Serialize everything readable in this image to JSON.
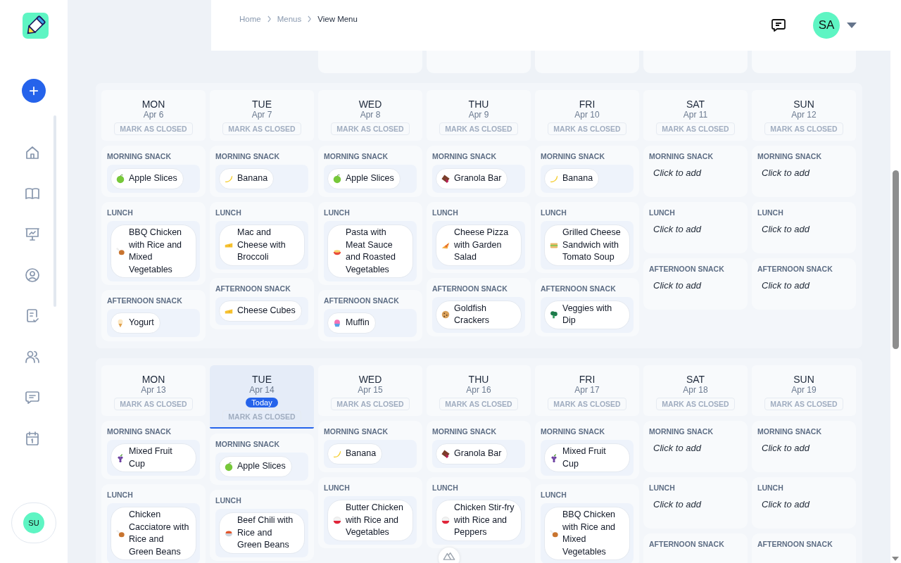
{
  "breadcrumb": [
    {
      "label": "Home",
      "current": false
    },
    {
      "label": "Menus",
      "current": false
    },
    {
      "label": "View Menu",
      "current": true
    }
  ],
  "user": {
    "initials": "SA"
  },
  "sidebar_user": {
    "initials": "SU"
  },
  "weeks": [
    {
      "days": [
        {
          "day": "MON",
          "date": "Apr 6",
          "today": false,
          "action": "MARK AS CLOSED",
          "meals": [
            {
              "label": "MORNING SNACK",
              "items": [
                {
                  "name": "Apple Slices",
                  "kind": "apple"
                }
              ]
            },
            {
              "label": "LUNCH",
              "items": [
                {
                  "name": "BBQ Chicken with Rice and Mixed Vegetables",
                  "kind": "drumstick"
                }
              ]
            },
            {
              "label": "AFTERNOON SNACK",
              "items": [
                {
                  "name": "Yogurt",
                  "kind": "icecream"
                }
              ]
            }
          ]
        },
        {
          "day": "TUE",
          "date": "Apr 7",
          "today": false,
          "action": "MARK AS CLOSED",
          "meals": [
            {
              "label": "MORNING SNACK",
              "items": [
                {
                  "name": "Banana",
                  "kind": "banana"
                }
              ]
            },
            {
              "label": "LUNCH",
              "items": [
                {
                  "name": "Mac and Cheese with Broccoli",
                  "kind": "cheese"
                }
              ]
            },
            {
              "label": "AFTERNOON SNACK",
              "items": [
                {
                  "name": "Cheese Cubes",
                  "kind": "cheese"
                }
              ]
            }
          ]
        },
        {
          "day": "WED",
          "date": "Apr 8",
          "today": false,
          "action": "MARK AS CLOSED",
          "meals": [
            {
              "label": "MORNING SNACK",
              "items": [
                {
                  "name": "Apple Slices",
                  "kind": "apple"
                }
              ]
            },
            {
              "label": "LUNCH",
              "items": [
                {
                  "name": "Pasta with Meat Sauce and Roasted Vegetables",
                  "kind": "pasta"
                }
              ]
            },
            {
              "label": "AFTERNOON SNACK",
              "items": [
                {
                  "name": "Muffin",
                  "kind": "cupcake"
                }
              ]
            }
          ]
        },
        {
          "day": "THU",
          "date": "Apr 9",
          "today": false,
          "action": "MARK AS CLOSED",
          "meals": [
            {
              "label": "MORNING SNACK",
              "items": [
                {
                  "name": "Granola Bar",
                  "kind": "chocolate"
                }
              ]
            },
            {
              "label": "LUNCH",
              "items": [
                {
                  "name": "Cheese Pizza with Garden Salad",
                  "kind": "pizza"
                }
              ]
            },
            {
              "label": "AFTERNOON SNACK",
              "items": [
                {
                  "name": "Goldfish Crackers",
                  "kind": "cookie"
                }
              ]
            }
          ]
        },
        {
          "day": "FRI",
          "date": "Apr 10",
          "today": false,
          "action": "MARK AS CLOSED",
          "meals": [
            {
              "label": "MORNING SNACK",
              "items": [
                {
                  "name": "Banana",
                  "kind": "banana"
                }
              ]
            },
            {
              "label": "LUNCH",
              "items": [
                {
                  "name": "Grilled Cheese Sandwich with Tomato Soup",
                  "kind": "sandwich"
                }
              ]
            },
            {
              "label": "AFTERNOON SNACK",
              "items": [
                {
                  "name": "Veggies with Dip",
                  "kind": "broccoli"
                }
              ]
            }
          ]
        },
        {
          "day": "SAT",
          "date": "Apr 11",
          "today": false,
          "action": "MARK AS CLOSED",
          "meals": [
            {
              "label": "MORNING SNACK",
              "prompt": "Click to add"
            },
            {
              "label": "LUNCH",
              "prompt": "Click to add"
            },
            {
              "label": "AFTERNOON SNACK",
              "prompt": "Click to add"
            }
          ]
        },
        {
          "day": "SUN",
          "date": "Apr 12",
          "today": false,
          "action": "MARK AS CLOSED",
          "meals": [
            {
              "label": "MORNING SNACK",
              "prompt": "Click to add"
            },
            {
              "label": "LUNCH",
              "prompt": "Click to add"
            },
            {
              "label": "AFTERNOON SNACK",
              "prompt": "Click to add"
            }
          ]
        }
      ]
    },
    {
      "days": [
        {
          "day": "MON",
          "date": "Apr 13",
          "today": false,
          "action": "MARK AS CLOSED",
          "meals": [
            {
              "label": "MORNING SNACK",
              "items": [
                {
                  "name": "Mixed Fruit Cup",
                  "kind": "grapes"
                }
              ]
            },
            {
              "label": "LUNCH",
              "items": [
                {
                  "name": "Chicken Cacciatore with Rice and Green Beans",
                  "kind": "drumstick"
                }
              ]
            }
          ]
        },
        {
          "day": "TUE",
          "date": "Apr 14",
          "today": true,
          "badge": "Today",
          "action": "MARK AS CLOSED",
          "meals": [
            {
              "label": "MORNING SNACK",
              "items": [
                {
                  "name": "Apple Slices",
                  "kind": "apple"
                }
              ]
            },
            {
              "label": "LUNCH",
              "items": [
                {
                  "name": "Beef Chili with Rice and Green Beans",
                  "kind": "stew"
                }
              ]
            }
          ]
        },
        {
          "day": "WED",
          "date": "Apr 15",
          "today": false,
          "action": "MARK AS CLOSED",
          "meals": [
            {
              "label": "MORNING SNACK",
              "items": [
                {
                  "name": "Banana",
                  "kind": "banana"
                }
              ]
            },
            {
              "label": "LUNCH",
              "items": [
                {
                  "name": "Butter Chicken with Rice and Vegetables",
                  "kind": "rice"
                }
              ]
            }
          ]
        },
        {
          "day": "THU",
          "date": "Apr 16",
          "today": false,
          "action": "MARK AS CLOSED",
          "meals": [
            {
              "label": "MORNING SNACK",
              "items": [
                {
                  "name": "Granola Bar",
                  "kind": "chocolate"
                }
              ]
            },
            {
              "label": "LUNCH",
              "items": [
                {
                  "name": "Chicken Stir-fry with Rice and Peppers",
                  "kind": "rice"
                }
              ]
            }
          ]
        },
        {
          "day": "FRI",
          "date": "Apr 17",
          "today": false,
          "action": "MARK AS CLOSED",
          "meals": [
            {
              "label": "MORNING SNACK",
              "items": [
                {
                  "name": "Mixed Fruit Cup",
                  "kind": "grapes"
                }
              ]
            },
            {
              "label": "LUNCH",
              "items": [
                {
                  "name": "BBQ Chicken with Rice and Mixed Vegetables",
                  "kind": "drumstick"
                }
              ]
            }
          ]
        },
        {
          "day": "SAT",
          "date": "Apr 18",
          "today": false,
          "action": "MARK AS CLOSED",
          "meals": [
            {
              "label": "MORNING SNACK",
              "prompt": "Click to add"
            },
            {
              "label": "LUNCH",
              "prompt": "Click to add"
            },
            {
              "label": "AFTERNOON SNACK"
            }
          ]
        },
        {
          "day": "SUN",
          "date": "Apr 19",
          "today": false,
          "action": "MARK AS CLOSED",
          "meals": [
            {
              "label": "MORNING SNACK",
              "prompt": "Click to add"
            },
            {
              "label": "LUNCH",
              "prompt": "Click to add"
            },
            {
              "label": "AFTERNOON SNACK"
            }
          ]
        }
      ]
    }
  ]
}
